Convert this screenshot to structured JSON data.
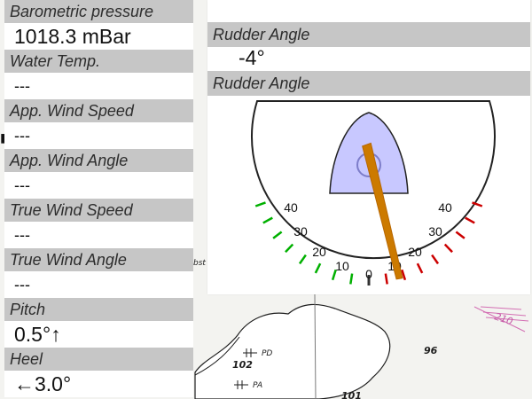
{
  "instruments": {
    "barometric_pressure": {
      "label": "Barometric pressure",
      "value": "1018.3 mBar"
    },
    "water_temp": {
      "label": "Water Temp.",
      "value": "---"
    },
    "app_wind_speed": {
      "label": "App. Wind Speed",
      "value": "---"
    },
    "app_wind_angle": {
      "label": "App. Wind Angle",
      "value": "---"
    },
    "true_wind_speed": {
      "label": "True Wind Speed",
      "value": "---"
    },
    "true_wind_angle": {
      "label": "True Wind Angle",
      "value": "---"
    },
    "pitch": {
      "label": "Pitch",
      "value": "0.5°↑"
    },
    "heel": {
      "label": "Heel",
      "value": "←3.0°"
    }
  },
  "rudder": {
    "numeric_label": "Rudder Angle",
    "numeric_value": "-4°",
    "gauge_label": "Rudder Angle",
    "gauge_value_deg": -4,
    "scale_labels": [
      "40",
      "30",
      "20",
      "10",
      "0",
      "10",
      "20",
      "30",
      "40"
    ]
  },
  "chart_background": {
    "labels": {
      "left_fragment": "bst",
      "soundings": [
        "96",
        "102",
        "101"
      ],
      "pd": "PD",
      "pa": "PA",
      "heading": "210"
    }
  }
}
